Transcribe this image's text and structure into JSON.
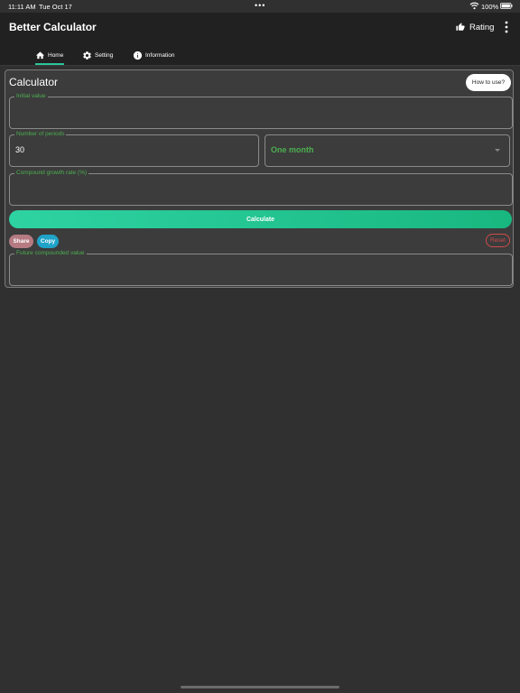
{
  "status": {
    "time": "11:11 AM",
    "date": "Tue Oct 17",
    "dots": "•••",
    "battery_pct": "100%"
  },
  "app": {
    "title": "Better Calculator",
    "rating_label": "Rating"
  },
  "tabs": [
    {
      "label": "Home",
      "icon": "home-icon",
      "active": true
    },
    {
      "label": "Setting",
      "icon": "gear-icon",
      "active": false
    },
    {
      "label": "Information",
      "icon": "info-icon",
      "active": false
    }
  ],
  "card": {
    "title": "Calculator",
    "how_to_label": "How to use?",
    "initial_value": {
      "label": "Initial value",
      "value": ""
    },
    "periods": {
      "label": "Number of periods",
      "value": "30"
    },
    "period_unit": {
      "value": "One month"
    },
    "growth_rate": {
      "label": "Compound growth rate (%)",
      "value": ""
    },
    "calculate_label": "Calculate",
    "share_label": "Share",
    "copy_label": "Copy",
    "reset_label": "Reset",
    "future_value": {
      "label": "Future compounded value",
      "value": ""
    }
  },
  "colors": {
    "background": "#303030",
    "app_bar": "#212121",
    "accent_green": "#4caf50",
    "calculate_gradient_start": "#2ed3a2",
    "calculate_gradient_end": "#19b780",
    "share": "#b57a82",
    "copy": "#1fa3c8",
    "reset": "#d04a4a"
  }
}
